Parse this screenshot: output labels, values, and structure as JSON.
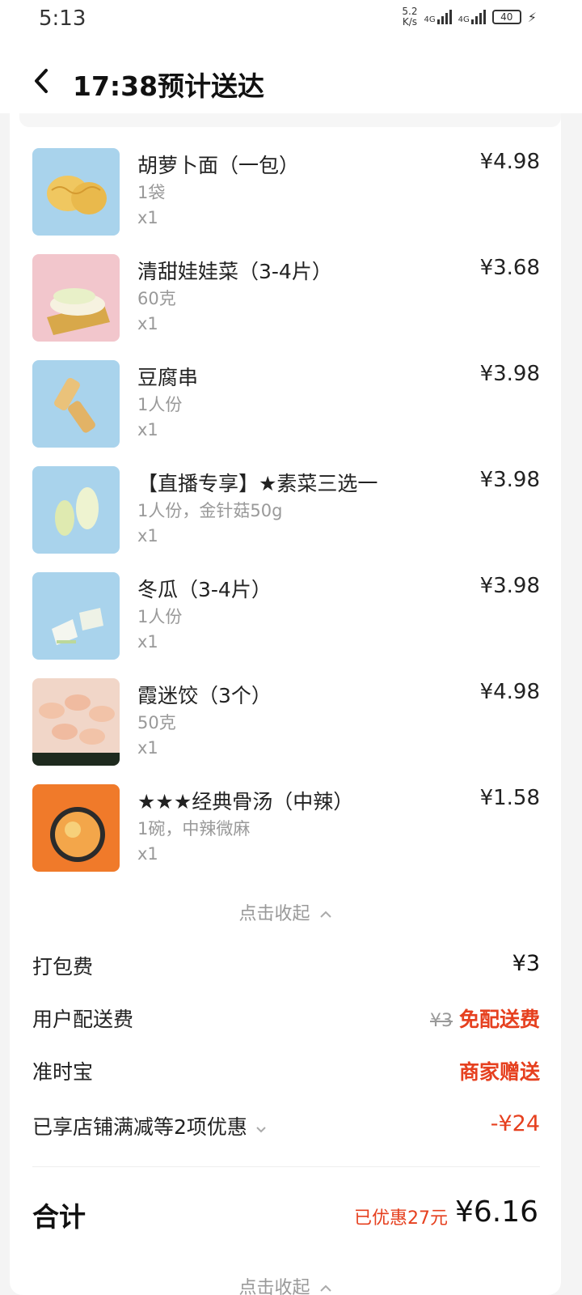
{
  "status_bar": {
    "time": "5:13",
    "net_speed_value": "5.2",
    "net_speed_unit": "K/s",
    "signal1": "4G",
    "signal2": "4G",
    "battery": "40"
  },
  "header": {
    "title": "17:38预计送达",
    "back_icon": "chevron-left-icon"
  },
  "items": [
    {
      "name": "胡萝卜面（一包）",
      "spec": "1袋",
      "qty": "x1",
      "price": "¥4.98"
    },
    {
      "name": "清甜娃娃菜（3-4片）",
      "spec": "60克",
      "qty": "x1",
      "price": "¥3.68"
    },
    {
      "name": "豆腐串",
      "spec": "1人份",
      "qty": "x1",
      "price": "¥3.98"
    },
    {
      "name": "【直播专享】★素菜三选一",
      "spec": "1人份，金针菇50g",
      "qty": "x1",
      "price": "¥3.98"
    },
    {
      "name": "冬瓜（3-4片）",
      "spec": "1人份",
      "qty": "x1",
      "price": "¥3.98"
    },
    {
      "name": "霞迷饺（3个）",
      "spec": "50克",
      "qty": "x1",
      "price": "¥4.98"
    },
    {
      "name": "★★★经典骨汤（中辣）",
      "spec": "1碗，中辣微麻",
      "qty": "x1",
      "price": "¥1.58"
    }
  ],
  "collapse_label": "点击收起",
  "fees": {
    "packing": {
      "label": "打包费",
      "value": "¥3"
    },
    "delivery": {
      "label": "用户配送费",
      "original": "¥3",
      "value": "免配送费"
    },
    "ontime": {
      "label": "准时宝",
      "value": "商家赠送"
    },
    "discount": {
      "label": "已享店铺满减等2项优惠",
      "value": "-¥24"
    }
  },
  "total": {
    "label": "合计",
    "saved": "已优惠27元",
    "value": "¥6.16"
  },
  "colors": {
    "accent_red": "#e6401f",
    "text_gray": "#999999"
  }
}
